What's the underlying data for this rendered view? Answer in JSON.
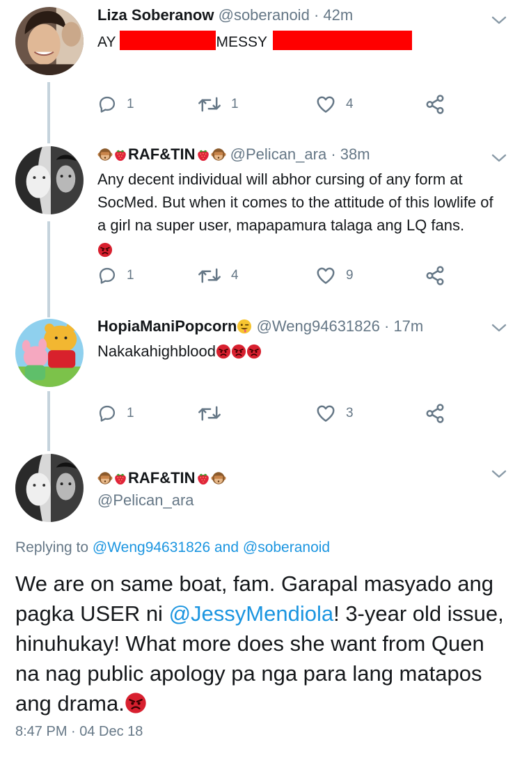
{
  "tweets": [
    {
      "name": "Liza Soberanow",
      "handle": "@soberanoid",
      "time": "· 42m",
      "text_prefix": "AY",
      "text_middle": "MESSY",
      "replies": "1",
      "retweets": "1",
      "likes": "4"
    },
    {
      "name": "RAF&TIN",
      "handle": "@Pelican_ara",
      "time": "· 38m",
      "text": "Any decent individual will abhor cursing of any form at SocMed. But when it comes to the attitude of this lowlife of a girl na super user, mapapamura talaga ang LQ fans.",
      "replies": "1",
      "retweets": "4",
      "likes": "9"
    },
    {
      "name": "HopiaManiPopcorn",
      "handle": "@Weng94631826",
      "time": "· 17m",
      "text": "Nakakahighblood",
      "replies": "1",
      "retweets": "",
      "likes": "3"
    }
  ],
  "main_tweet": {
    "name": "RAF&TIN",
    "handle": "@Pelican_ara",
    "replying_label": "Replying to",
    "reply_to_1": "@Weng94631826",
    "reply_and": "and",
    "reply_to_2": "@soberanoid",
    "text_1": "We are on same boat, fam. Garapal masyado ang pagka USER ni",
    "mention": "@JessyMendiola",
    "text_2": "!  3-year old issue, hinuhukay! What more does she want from Quen na nag public apology pa nga para lang matapos ang drama.",
    "timestamp": "8:47 PM · 04 Dec 18"
  },
  "colors": {
    "text": "#14171a",
    "secondary": "#657786",
    "link": "#1b95e0",
    "thread_line": "#c5d3dc",
    "redaction": "#ff0000"
  },
  "icons": [
    "reply-icon",
    "retweet-icon",
    "like-icon",
    "share-icon",
    "chevron-down-icon",
    "monkey-emoji",
    "strawberry-emoji",
    "angry-face-emoji",
    "winking-tongue-emoji"
  ]
}
